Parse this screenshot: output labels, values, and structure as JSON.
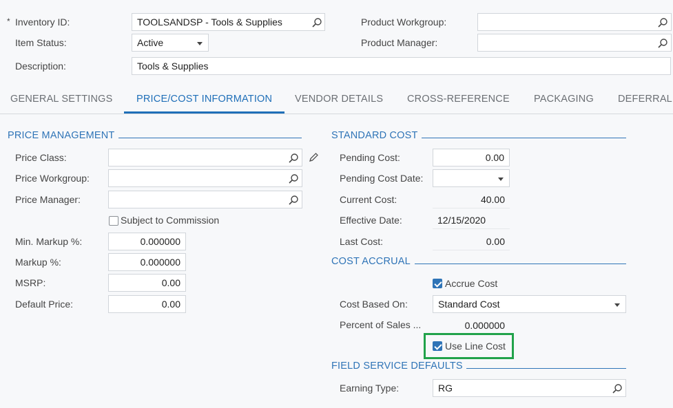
{
  "header": {
    "inventory_id": {
      "label": "Inventory ID:",
      "required_mark": "*",
      "value": "TOOLSANDSP - Tools & Supplies"
    },
    "item_status": {
      "label": "Item Status:",
      "value": "Active"
    },
    "description": {
      "label": "Description:",
      "value": "Tools & Supplies"
    },
    "product_workgroup": {
      "label": "Product Workgroup:",
      "value": ""
    },
    "product_manager": {
      "label": "Product Manager:",
      "value": ""
    }
  },
  "tabs": [
    {
      "label": "GENERAL SETTINGS",
      "active": false
    },
    {
      "label": "PRICE/COST INFORMATION",
      "active": true
    },
    {
      "label": "VENDOR DETAILS",
      "active": false
    },
    {
      "label": "CROSS-REFERENCE",
      "active": false
    },
    {
      "label": "PACKAGING",
      "active": false
    },
    {
      "label": "DEFERRAL",
      "active": false
    }
  ],
  "price_management": {
    "title": "PRICE MANAGEMENT",
    "price_class": {
      "label": "Price Class:",
      "value": ""
    },
    "price_workgroup": {
      "label": "Price Workgroup:",
      "value": ""
    },
    "price_manager": {
      "label": "Price Manager:",
      "value": ""
    },
    "subject_to_commission": {
      "label": "Subject to Commission",
      "checked": false
    },
    "min_markup": {
      "label": "Min. Markup %:",
      "value": "0.000000"
    },
    "markup": {
      "label": "Markup %:",
      "value": "0.000000"
    },
    "msrp": {
      "label": "MSRP:",
      "value": "0.00"
    },
    "default_price": {
      "label": "Default Price:",
      "value": "0.00"
    }
  },
  "standard_cost": {
    "title": "STANDARD COST",
    "pending_cost": {
      "label": "Pending Cost:",
      "value": "0.00"
    },
    "pending_cost_date": {
      "label": "Pending Cost Date:",
      "value": ""
    },
    "current_cost": {
      "label": "Current Cost:",
      "value": "40.00"
    },
    "effective_date": {
      "label": "Effective Date:",
      "value": "12/15/2020"
    },
    "last_cost": {
      "label": "Last Cost:",
      "value": "0.00"
    }
  },
  "cost_accrual": {
    "title": "COST ACCRUAL",
    "accrue_cost": {
      "label": "Accrue Cost",
      "checked": true
    },
    "cost_based_on": {
      "label": "Cost Based On:",
      "value": "Standard Cost"
    },
    "percent_of_sales": {
      "label": "Percent of Sales ...",
      "value": "0.000000"
    },
    "use_line_cost": {
      "label": "Use Line Cost",
      "checked": true
    }
  },
  "field_service_defaults": {
    "title": "FIELD SERVICE DEFAULTS",
    "earning_type": {
      "label": "Earning Type:",
      "value": "RG"
    }
  },
  "colors": {
    "accent": "#2f74b7",
    "highlight": "#21a24a",
    "background": "#f7f8fa"
  }
}
